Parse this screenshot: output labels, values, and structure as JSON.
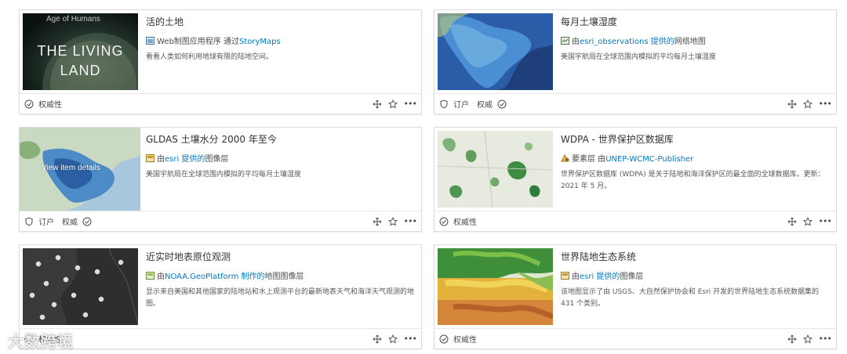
{
  "cards": [
    {
      "title": "活的土地",
      "thumb_text_line1": "Age of Humans",
      "thumb_text_line2": "THE LIVING",
      "thumb_text_line3": "LAND",
      "type_label": "Web制图应用程序 通过",
      "type_link": "StoryMaps",
      "desc": "看看人类如何利用地球有限的陆地空间。",
      "footer_labels": [
        "权威性"
      ]
    },
    {
      "title": "每月土壤湿度",
      "type_prefix": "由",
      "type_link": "esri_observations 提供的",
      "type_suffix": "网络地图",
      "desc": "美国宇航局在全球范围内模拟的平均每月土壤湿度",
      "footer_labels": [
        "订户",
        "权威"
      ]
    },
    {
      "title": "GLDAS 土壤水分 2000 年至今",
      "thumb_overlay": "View item details",
      "type_prefix": "由",
      "type_link": "esri 提供的",
      "type_suffix": "图像层",
      "desc": "美国宇航局在全球范围内模拟的平均每月土壤湿度",
      "footer_labels": [
        "订户",
        "权威"
      ]
    },
    {
      "title": "WDPA - 世界保护区数据库",
      "type_prefix": "要素层 由",
      "type_link": "UNEP-WCMC-Publisher",
      "desc": "世界保护区数据库 (WDPA) 是关于陆地和海洋保护区的最全面的全球数据库。更新：2021 年 5 月。",
      "footer_labels": [
        "权威性"
      ]
    },
    {
      "title": "近实时地表原位观测",
      "type_prefix": "由",
      "type_link": "NOAA.GeoPlatform 制作的",
      "type_suffix": "地图图像层",
      "desc": "显示来自美国和其他国家的陆地站和水上观测平台的最新地表天气和海洋天气观测的地图。",
      "footer_labels": [
        "权威性"
      ]
    },
    {
      "title": "世界陆地生态系统",
      "type_prefix": "由",
      "type_link": "esri 提供的",
      "type_suffix": "图像层",
      "desc": "该地图显示了由 USGS、大自然保护协会和 Esri 开发的世界陆地生态系统数据集的 431 个类别。",
      "footer_labels": [
        "权威性"
      ]
    }
  ],
  "watermark": "大数跨境",
  "colors": {
    "link": "#0079c1",
    "border": "#dcdcdc",
    "text": "#4c4c4c"
  },
  "icons": [
    "authoritative-check-icon",
    "subscriber-shield-icon",
    "move-icon",
    "favorite-star-icon",
    "more-dots-icon",
    "app-type-icon",
    "webmap-type-icon",
    "imagery-layer-type-icon",
    "feature-layer-type-icon"
  ]
}
